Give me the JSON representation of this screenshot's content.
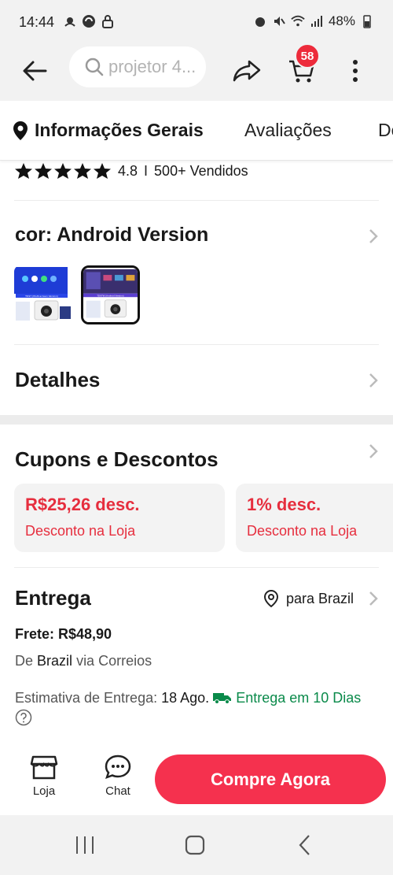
{
  "status_bar": {
    "time": "14:44",
    "battery": "48%"
  },
  "search": {
    "query": "projetor 4..."
  },
  "cart": {
    "count": "58"
  },
  "tabs": [
    {
      "label": "Informações Gerais"
    },
    {
      "label": "Avaliações"
    },
    {
      "label": "De"
    }
  ],
  "rating": {
    "score": "4.8",
    "separator": "I",
    "sold": "500+ Vendidos"
  },
  "color": {
    "title": "cor: Android Version",
    "options": [
      {
        "caption": "TD97 (Multi-screen Version)"
      },
      {
        "caption": "TD97W (Android Version)"
      }
    ]
  },
  "details": {
    "title": "Detalhes"
  },
  "coupons": {
    "title": "Cupons e Descontos",
    "items": [
      {
        "title": "R$25,26 desc.",
        "subtitle": "Desconto na Loja"
      },
      {
        "title": "1% desc.",
        "subtitle": "Desconto na Loja"
      }
    ]
  },
  "delivery": {
    "title": "Entrega",
    "ship_to": "para Brazil",
    "freight": "Frete: R$48,90",
    "origin_prefix": "De",
    "origin_country": "Brazil",
    "origin_suffix": "via Correios",
    "estimate_label": "Estimativa de Entrega:",
    "estimate_date": "18 Ago.",
    "estimate_green": "Entrega em 10 Dias"
  },
  "actions": {
    "store": "Loja",
    "chat": "Chat",
    "buy": "Compre Agora"
  },
  "colors": {
    "accent": "#f5314e",
    "badge": "#ed2b3b",
    "coupon_text": "#e62e3e",
    "green": "#0a8a4a"
  },
  "icons": [
    "back-arrow-icon",
    "search-icon",
    "share-icon",
    "cart-icon",
    "more-vertical-icon",
    "location-pin-icon",
    "star-icon",
    "chevron-right-icon",
    "map-pin-icon",
    "truck-icon",
    "help-circle-icon",
    "store-icon",
    "chat-icon",
    "recent-apps-icon",
    "home-icon",
    "nav-back-icon"
  ]
}
